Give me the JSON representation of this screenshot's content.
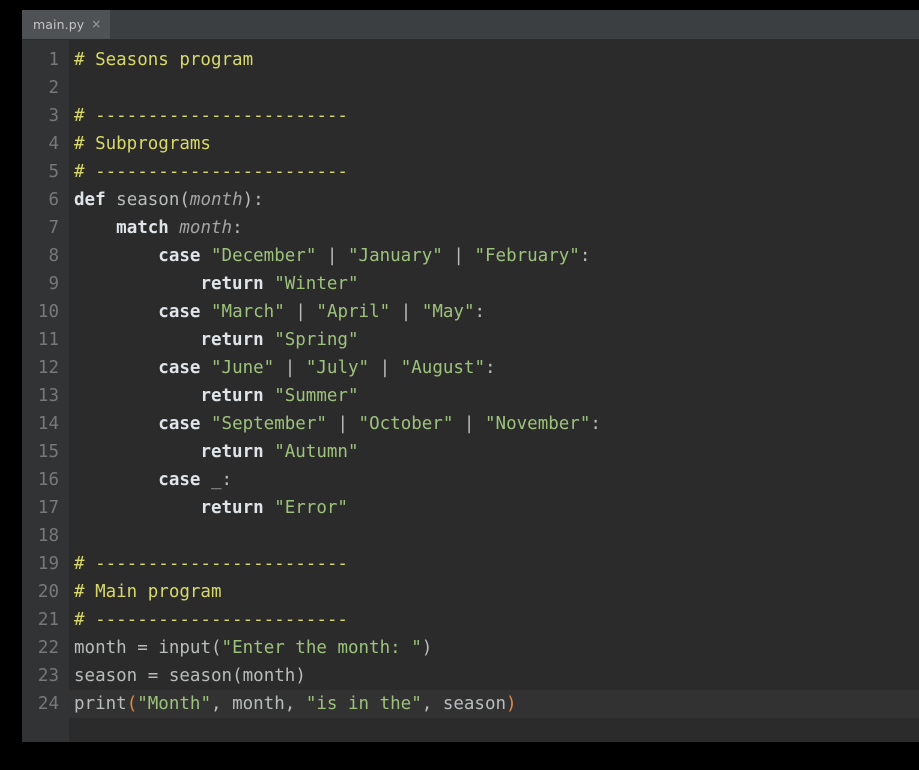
{
  "window": {
    "background": "#2b2b2b",
    "frame_color": "#000000"
  },
  "tabbar": {
    "background": "#3c3f41",
    "active_tab_background": "#4e5254",
    "tabs": [
      {
        "label": "main.py",
        "close_glyph": "×",
        "close_icon_name": "close-icon",
        "active": true
      }
    ]
  },
  "theme": {
    "comment": "#d9d96b",
    "keyword": "#dfe4e8",
    "string": "#9dc27c",
    "plain": "#b9bcbd",
    "param_italic": "#a4a4a4",
    "bracket_match": "#e08b42",
    "gutter_background": "#313335",
    "line_number": "#787878",
    "current_line_background": "#323232"
  },
  "editor": {
    "language": "python",
    "current_line": 24,
    "line_numbers": [
      "1",
      "2",
      "3",
      "4",
      "5",
      "6",
      "7",
      "8",
      "9",
      "10",
      "11",
      "12",
      "13",
      "14",
      "15",
      "16",
      "17",
      "18",
      "19",
      "20",
      "21",
      "22",
      "23",
      "24"
    ],
    "lines": [
      {
        "n": 1,
        "text": "# Seasons program",
        "tokens": [
          {
            "t": "comment",
            "v": "# Seasons program"
          }
        ]
      },
      {
        "n": 2,
        "text": "",
        "tokens": []
      },
      {
        "n": 3,
        "text": "# ------------------------",
        "tokens": [
          {
            "t": "comment",
            "v": "# ------------------------"
          }
        ]
      },
      {
        "n": 4,
        "text": "# Subprograms",
        "tokens": [
          {
            "t": "comment",
            "v": "# Subprograms"
          }
        ]
      },
      {
        "n": 5,
        "text": "# ------------------------",
        "tokens": [
          {
            "t": "comment",
            "v": "# ------------------------"
          }
        ]
      },
      {
        "n": 6,
        "text": "def season(month):",
        "tokens": [
          {
            "t": "keyword",
            "v": "def"
          },
          {
            "t": "plain",
            "v": " "
          },
          {
            "t": "func",
            "v": "season"
          },
          {
            "t": "punct",
            "v": "("
          },
          {
            "t": "param",
            "v": "month"
          },
          {
            "t": "punct",
            "v": "):"
          }
        ]
      },
      {
        "n": 7,
        "text": "    match month:",
        "tokens": [
          {
            "t": "plain",
            "v": "    "
          },
          {
            "t": "keyword",
            "v": "match"
          },
          {
            "t": "plain",
            "v": " "
          },
          {
            "t": "param",
            "v": "month"
          },
          {
            "t": "punct",
            "v": ":"
          }
        ]
      },
      {
        "n": 8,
        "text": "        case \"December\" | \"January\" | \"February\":",
        "tokens": [
          {
            "t": "plain",
            "v": "        "
          },
          {
            "t": "keyword",
            "v": "case"
          },
          {
            "t": "plain",
            "v": " "
          },
          {
            "t": "string",
            "v": "\"December\""
          },
          {
            "t": "plain",
            "v": " "
          },
          {
            "t": "pipe",
            "v": "|"
          },
          {
            "t": "plain",
            "v": " "
          },
          {
            "t": "string",
            "v": "\"January\""
          },
          {
            "t": "plain",
            "v": " "
          },
          {
            "t": "pipe",
            "v": "|"
          },
          {
            "t": "plain",
            "v": " "
          },
          {
            "t": "string",
            "v": "\"February\""
          },
          {
            "t": "punct",
            "v": ":"
          }
        ]
      },
      {
        "n": 9,
        "text": "            return \"Winter\"",
        "tokens": [
          {
            "t": "plain",
            "v": "            "
          },
          {
            "t": "keyword",
            "v": "return"
          },
          {
            "t": "plain",
            "v": " "
          },
          {
            "t": "string",
            "v": "\"Winter\""
          }
        ]
      },
      {
        "n": 10,
        "text": "        case \"March\" | \"April\" | \"May\":",
        "tokens": [
          {
            "t": "plain",
            "v": "        "
          },
          {
            "t": "keyword",
            "v": "case"
          },
          {
            "t": "plain",
            "v": " "
          },
          {
            "t": "string",
            "v": "\"March\""
          },
          {
            "t": "plain",
            "v": " "
          },
          {
            "t": "pipe",
            "v": "|"
          },
          {
            "t": "plain",
            "v": " "
          },
          {
            "t": "string",
            "v": "\"April\""
          },
          {
            "t": "plain",
            "v": " "
          },
          {
            "t": "pipe",
            "v": "|"
          },
          {
            "t": "plain",
            "v": " "
          },
          {
            "t": "string",
            "v": "\"May\""
          },
          {
            "t": "punct",
            "v": ":"
          }
        ]
      },
      {
        "n": 11,
        "text": "            return \"Spring\"",
        "tokens": [
          {
            "t": "plain",
            "v": "            "
          },
          {
            "t": "keyword",
            "v": "return"
          },
          {
            "t": "plain",
            "v": " "
          },
          {
            "t": "string",
            "v": "\"Spring\""
          }
        ]
      },
      {
        "n": 12,
        "text": "        case \"June\" | \"July\" | \"August\":",
        "tokens": [
          {
            "t": "plain",
            "v": "        "
          },
          {
            "t": "keyword",
            "v": "case"
          },
          {
            "t": "plain",
            "v": " "
          },
          {
            "t": "string",
            "v": "\"June\""
          },
          {
            "t": "plain",
            "v": " "
          },
          {
            "t": "pipe",
            "v": "|"
          },
          {
            "t": "plain",
            "v": " "
          },
          {
            "t": "string",
            "v": "\"July\""
          },
          {
            "t": "plain",
            "v": " "
          },
          {
            "t": "pipe",
            "v": "|"
          },
          {
            "t": "plain",
            "v": " "
          },
          {
            "t": "string",
            "v": "\"August\""
          },
          {
            "t": "punct",
            "v": ":"
          }
        ]
      },
      {
        "n": 13,
        "text": "            return \"Summer\"",
        "tokens": [
          {
            "t": "plain",
            "v": "            "
          },
          {
            "t": "keyword",
            "v": "return"
          },
          {
            "t": "plain",
            "v": " "
          },
          {
            "t": "string",
            "v": "\"Summer\""
          }
        ]
      },
      {
        "n": 14,
        "text": "        case \"September\" | \"October\" | \"November\":",
        "tokens": [
          {
            "t": "plain",
            "v": "        "
          },
          {
            "t": "keyword",
            "v": "case"
          },
          {
            "t": "plain",
            "v": " "
          },
          {
            "t": "string",
            "v": "\"September\""
          },
          {
            "t": "plain",
            "v": " "
          },
          {
            "t": "pipe",
            "v": "|"
          },
          {
            "t": "plain",
            "v": " "
          },
          {
            "t": "string",
            "v": "\"October\""
          },
          {
            "t": "plain",
            "v": " "
          },
          {
            "t": "pipe",
            "v": "|"
          },
          {
            "t": "plain",
            "v": " "
          },
          {
            "t": "string",
            "v": "\"November\""
          },
          {
            "t": "punct",
            "v": ":"
          }
        ]
      },
      {
        "n": 15,
        "text": "            return \"Autumn\"",
        "tokens": [
          {
            "t": "plain",
            "v": "            "
          },
          {
            "t": "keyword",
            "v": "return"
          },
          {
            "t": "plain",
            "v": " "
          },
          {
            "t": "string",
            "v": "\"Autumn\""
          }
        ]
      },
      {
        "n": 16,
        "text": "        case _:",
        "tokens": [
          {
            "t": "plain",
            "v": "        "
          },
          {
            "t": "keyword",
            "v": "case"
          },
          {
            "t": "plain",
            "v": " "
          },
          {
            "t": "plain",
            "v": "_"
          },
          {
            "t": "punct",
            "v": ":"
          }
        ]
      },
      {
        "n": 17,
        "text": "            return \"Error\"",
        "tokens": [
          {
            "t": "plain",
            "v": "            "
          },
          {
            "t": "keyword",
            "v": "return"
          },
          {
            "t": "plain",
            "v": " "
          },
          {
            "t": "string",
            "v": "\"Error\""
          }
        ]
      },
      {
        "n": 18,
        "text": "",
        "tokens": []
      },
      {
        "n": 19,
        "text": "# ------------------------",
        "tokens": [
          {
            "t": "comment",
            "v": "# ------------------------"
          }
        ]
      },
      {
        "n": 20,
        "text": "# Main program",
        "tokens": [
          {
            "t": "comment",
            "v": "# Main program"
          }
        ]
      },
      {
        "n": 21,
        "text": "# ------------------------",
        "tokens": [
          {
            "t": "comment",
            "v": "# ------------------------"
          }
        ]
      },
      {
        "n": 22,
        "text": "month = input(\"Enter the month: \")",
        "tokens": [
          {
            "t": "plain",
            "v": "month "
          },
          {
            "t": "punct",
            "v": "="
          },
          {
            "t": "plain",
            "v": " "
          },
          {
            "t": "func",
            "v": "input"
          },
          {
            "t": "punct",
            "v": "("
          },
          {
            "t": "string",
            "v": "\"Enter the month: \""
          },
          {
            "t": "punct",
            "v": ")"
          }
        ]
      },
      {
        "n": 23,
        "text": "season = season(month)",
        "tokens": [
          {
            "t": "plain",
            "v": "season "
          },
          {
            "t": "punct",
            "v": "="
          },
          {
            "t": "plain",
            "v": " "
          },
          {
            "t": "func",
            "v": "season"
          },
          {
            "t": "punct",
            "v": "("
          },
          {
            "t": "plain",
            "v": "month"
          },
          {
            "t": "punct",
            "v": ")"
          }
        ]
      },
      {
        "n": 24,
        "text": "print(\"Month\", month, \"is in the\", season)",
        "current": true,
        "tokens": [
          {
            "t": "func",
            "v": "print"
          },
          {
            "t": "bracket",
            "v": "("
          },
          {
            "t": "string",
            "v": "\"Month\""
          },
          {
            "t": "punct",
            "v": ", "
          },
          {
            "t": "plain",
            "v": "month"
          },
          {
            "t": "punct",
            "v": ", "
          },
          {
            "t": "string",
            "v": "\"is in the\""
          },
          {
            "t": "punct",
            "v": ", "
          },
          {
            "t": "plain",
            "v": "season"
          },
          {
            "t": "bracket",
            "v": ")"
          }
        ]
      }
    ]
  }
}
